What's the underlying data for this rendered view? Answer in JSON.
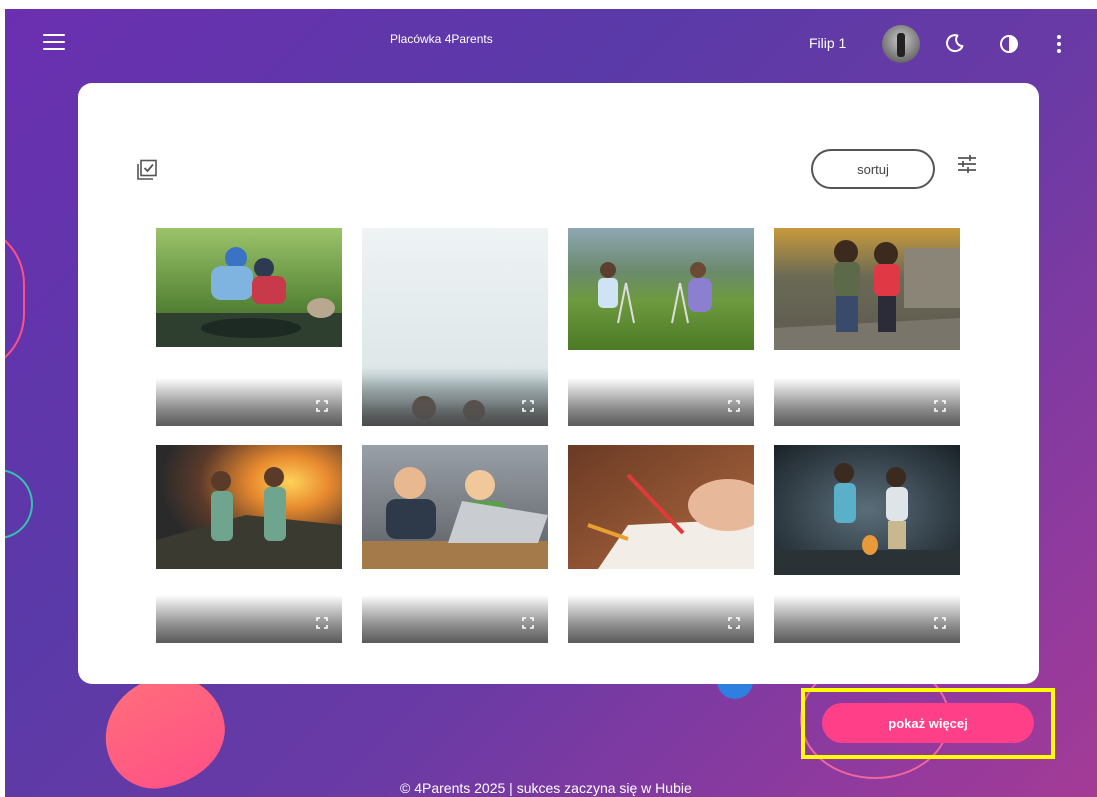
{
  "header": {
    "title": "Placówka 4Parents",
    "user_name": "Filip 1"
  },
  "gallery": {
    "sort_label": "sortuj",
    "tiles": [
      {
        "name": "children-by-water"
      },
      {
        "name": "children-fog-landscape"
      },
      {
        "name": "children-with-cameras"
      },
      {
        "name": "children-on-street"
      },
      {
        "name": "children-at-sunset"
      },
      {
        "name": "children-with-laptop"
      },
      {
        "name": "child-drawing"
      },
      {
        "name": "children-in-dark-forest"
      }
    ]
  },
  "actions": {
    "show_more_label": "pokaż więcej"
  },
  "footer": {
    "text": "© 4Parents 2025 | sukces zaczyna się w Hubie"
  },
  "colors": {
    "accent": "#ff3f87",
    "highlight": "#ffff00",
    "background_start": "#6b2fb0",
    "background_end": "#a43b96"
  }
}
